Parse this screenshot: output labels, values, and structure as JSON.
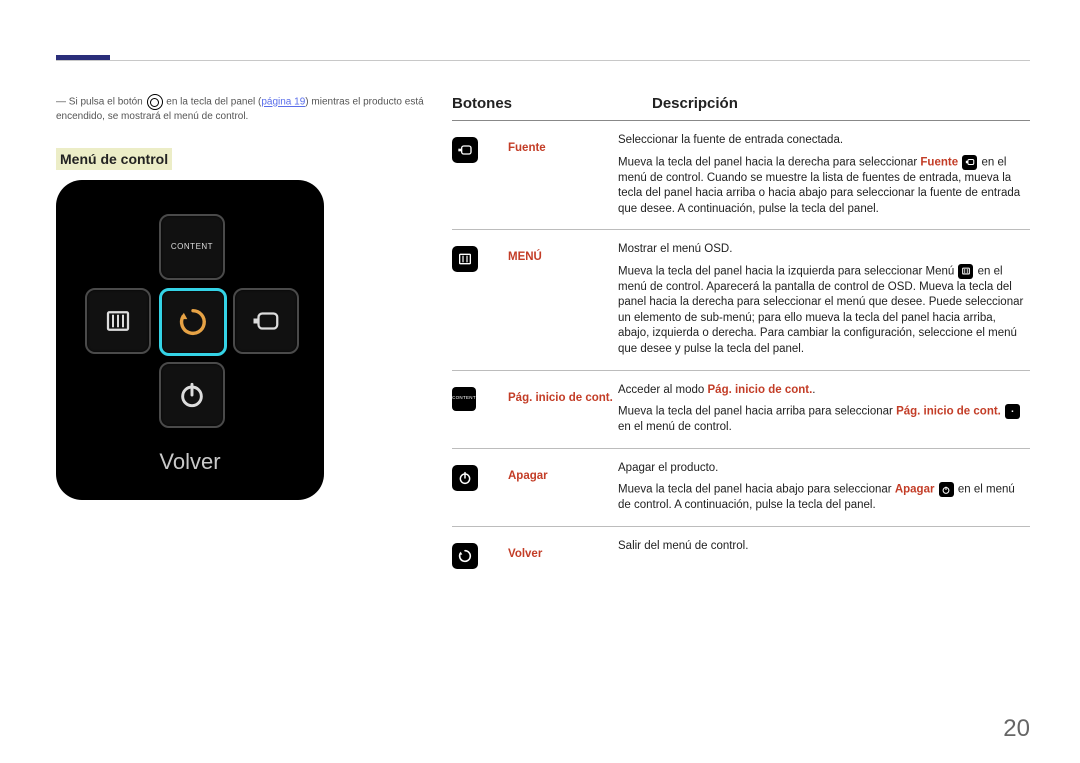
{
  "note": {
    "pre": "Si pulsa el botón ",
    "mid1": " en la tecla del panel (",
    "page_ref": "página 19",
    "mid2": ") mientras el producto está encendido, se mostrará el menú de control."
  },
  "menu_title": "Menú de control",
  "control_pad": {
    "top": "CONTENT",
    "bottom_text": "Volver"
  },
  "headers": {
    "botones": "Botones",
    "descripcion": "Descripción"
  },
  "rows": [
    {
      "icon": "source",
      "label": "Fuente",
      "intro": "Seleccionar la fuente de entrada conectada.",
      "body_pre": "Mueva la tecla del panel hacia la derecha para seleccionar ",
      "body_hl": "Fuente",
      "body_post": " en el menú de control. Cuando se muestre la lista de fuentes de entrada, mueva la tecla del panel hacia arriba o hacia abajo para seleccionar la fuente de entrada que desee. A continuación, pulse la tecla del panel.",
      "inline_icon": "source"
    },
    {
      "icon": "menu",
      "label": "MENÚ",
      "intro": "Mostrar el menú OSD.",
      "body_pre": "Mueva la tecla del panel hacia la izquierda para seleccionar Menú ",
      "body_hl": "",
      "body_post": " en el menú de control. Aparecerá la pantalla de control de OSD. Mueva la tecla del panel hacia la derecha para seleccionar el menú que desee. Puede seleccionar un elemento de sub-menú; para ello mueva la tecla del panel hacia arriba, abajo, izquierda o derecha. Para cambiar la configuración, seleccione el menú que desee y pulse la tecla del panel.",
      "inline_icon": "menu"
    },
    {
      "icon": "content",
      "label": "Pág. inicio de cont.",
      "intro_pre": "Acceder al modo ",
      "intro_hl": "Pág. inicio de cont.",
      "intro_post": ".",
      "body_pre": "Mueva la tecla del panel hacia arriba para seleccionar ",
      "body_hl": "Pág. inicio de cont.",
      "body_post": " en el menú de control.",
      "inline_icon": "content"
    },
    {
      "icon": "power",
      "label": "Apagar",
      "intro": "Apagar el producto.",
      "body_pre": "Mueva la tecla del panel hacia abajo para seleccionar ",
      "body_hl": "Apagar",
      "body_post": " en el menú de control. A continuación, pulse la tecla del panel.",
      "inline_icon": "power"
    },
    {
      "icon": "return",
      "label": "Volver",
      "intro": "Salir del menú de control.",
      "body_pre": "",
      "body_hl": "",
      "body_post": "",
      "inline_icon": ""
    }
  ],
  "page_number": "20"
}
